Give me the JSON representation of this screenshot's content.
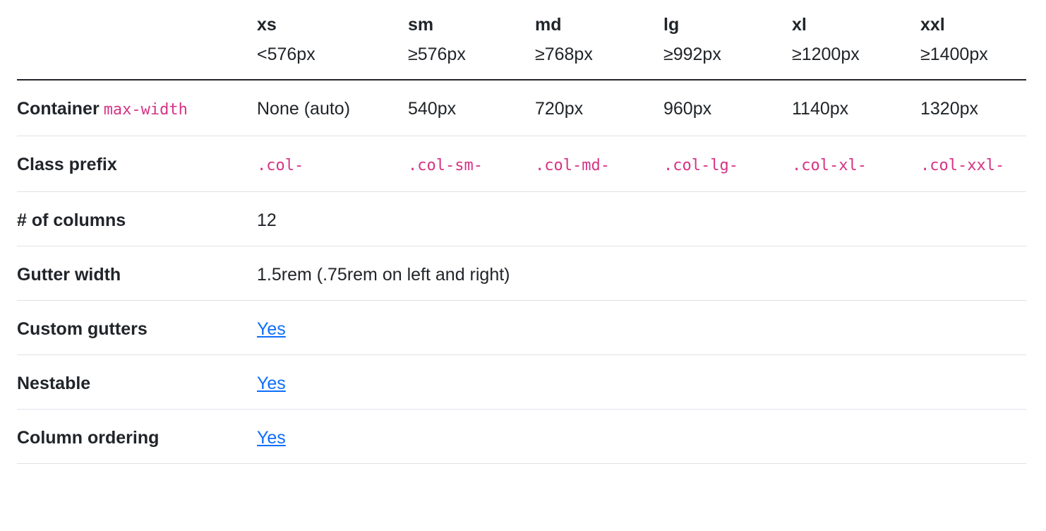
{
  "header": {
    "breakpoints": [
      {
        "name": "xs",
        "range": "<576px"
      },
      {
        "name": "sm",
        "range": "≥576px"
      },
      {
        "name": "md",
        "range": "≥768px"
      },
      {
        "name": "lg",
        "range": "≥992px"
      },
      {
        "name": "xl",
        "range": "≥1200px"
      },
      {
        "name": "xxl",
        "range": "≥1400px"
      }
    ]
  },
  "rows": {
    "container": {
      "label": "Container",
      "code": "max-width",
      "values": [
        "None (auto)",
        "540px",
        "720px",
        "960px",
        "1140px",
        "1320px"
      ]
    },
    "class_prefix": {
      "label": "Class prefix",
      "values": [
        ".col-",
        ".col-sm-",
        ".col-md-",
        ".col-lg-",
        ".col-xl-",
        ".col-xxl-"
      ]
    },
    "columns": {
      "label": "# of columns",
      "value": "12"
    },
    "gutter": {
      "label": "Gutter width",
      "value": "1.5rem (.75rem on left and right)"
    },
    "custom_gutters": {
      "label": "Custom gutters",
      "value": "Yes"
    },
    "nestable": {
      "label": "Nestable",
      "value": "Yes"
    },
    "ordering": {
      "label": "Column ordering",
      "value": "Yes"
    }
  },
  "colors": {
    "text": "#212529",
    "code": "#d63384",
    "link": "#0d6efd",
    "row_border": "#dee2e6"
  }
}
